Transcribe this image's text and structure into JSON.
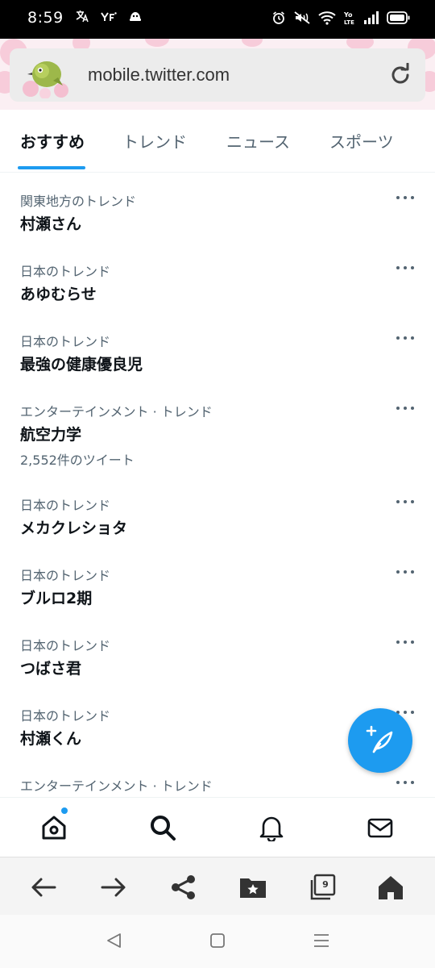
{
  "status_bar": {
    "time": "8:59",
    "left_icons": [
      "translate-icon",
      "yahoo-icon",
      "app-icon"
    ],
    "right_icons": [
      "alarm-icon",
      "mute-icon",
      "wifi-icon",
      "volte-icon",
      "signal-icon",
      "battery-icon"
    ]
  },
  "browser": {
    "url": "mobile.twitter.com"
  },
  "tabs": [
    {
      "label": "おすすめ",
      "active": true
    },
    {
      "label": "トレンド",
      "active": false
    },
    {
      "label": "ニュース",
      "active": false
    },
    {
      "label": "スポーツ",
      "active": false
    }
  ],
  "trends": [
    {
      "context": "関東地方のトレンド",
      "name": "村瀬さん",
      "count": ""
    },
    {
      "context": "日本のトレンド",
      "name": "あゆむらせ",
      "count": ""
    },
    {
      "context": "日本のトレンド",
      "name": "最強の健康優良児",
      "count": ""
    },
    {
      "context": "エンターテインメント · トレンド",
      "name": "航空力学",
      "count": "2,552件のツイート"
    },
    {
      "context": "日本のトレンド",
      "name": "メカクレショタ",
      "count": ""
    },
    {
      "context": "日本のトレンド",
      "name": "ブルロ2期",
      "count": ""
    },
    {
      "context": "日本のトレンド",
      "name": "つばさ君",
      "count": ""
    },
    {
      "context": "日本のトレンド",
      "name": "村瀬くん",
      "count": ""
    },
    {
      "context": "エンターテインメント · トレンド",
      "name": "",
      "count": ""
    }
  ],
  "bottom_nav": [
    "home-icon",
    "search-icon",
    "notifications-icon",
    "messages-icon"
  ],
  "browser_toolbar": {
    "icons": [
      "back-icon",
      "forward-icon",
      "share-icon",
      "bookmark-folder-icon",
      "tabs-icon",
      "home-icon"
    ],
    "tab_count": "9"
  },
  "android_nav": [
    "back-triangle-icon",
    "home-square-icon",
    "recents-icon"
  ],
  "colors": {
    "accent": "#1d9bf0",
    "text_primary": "#0f1419",
    "text_secondary": "#536471"
  }
}
